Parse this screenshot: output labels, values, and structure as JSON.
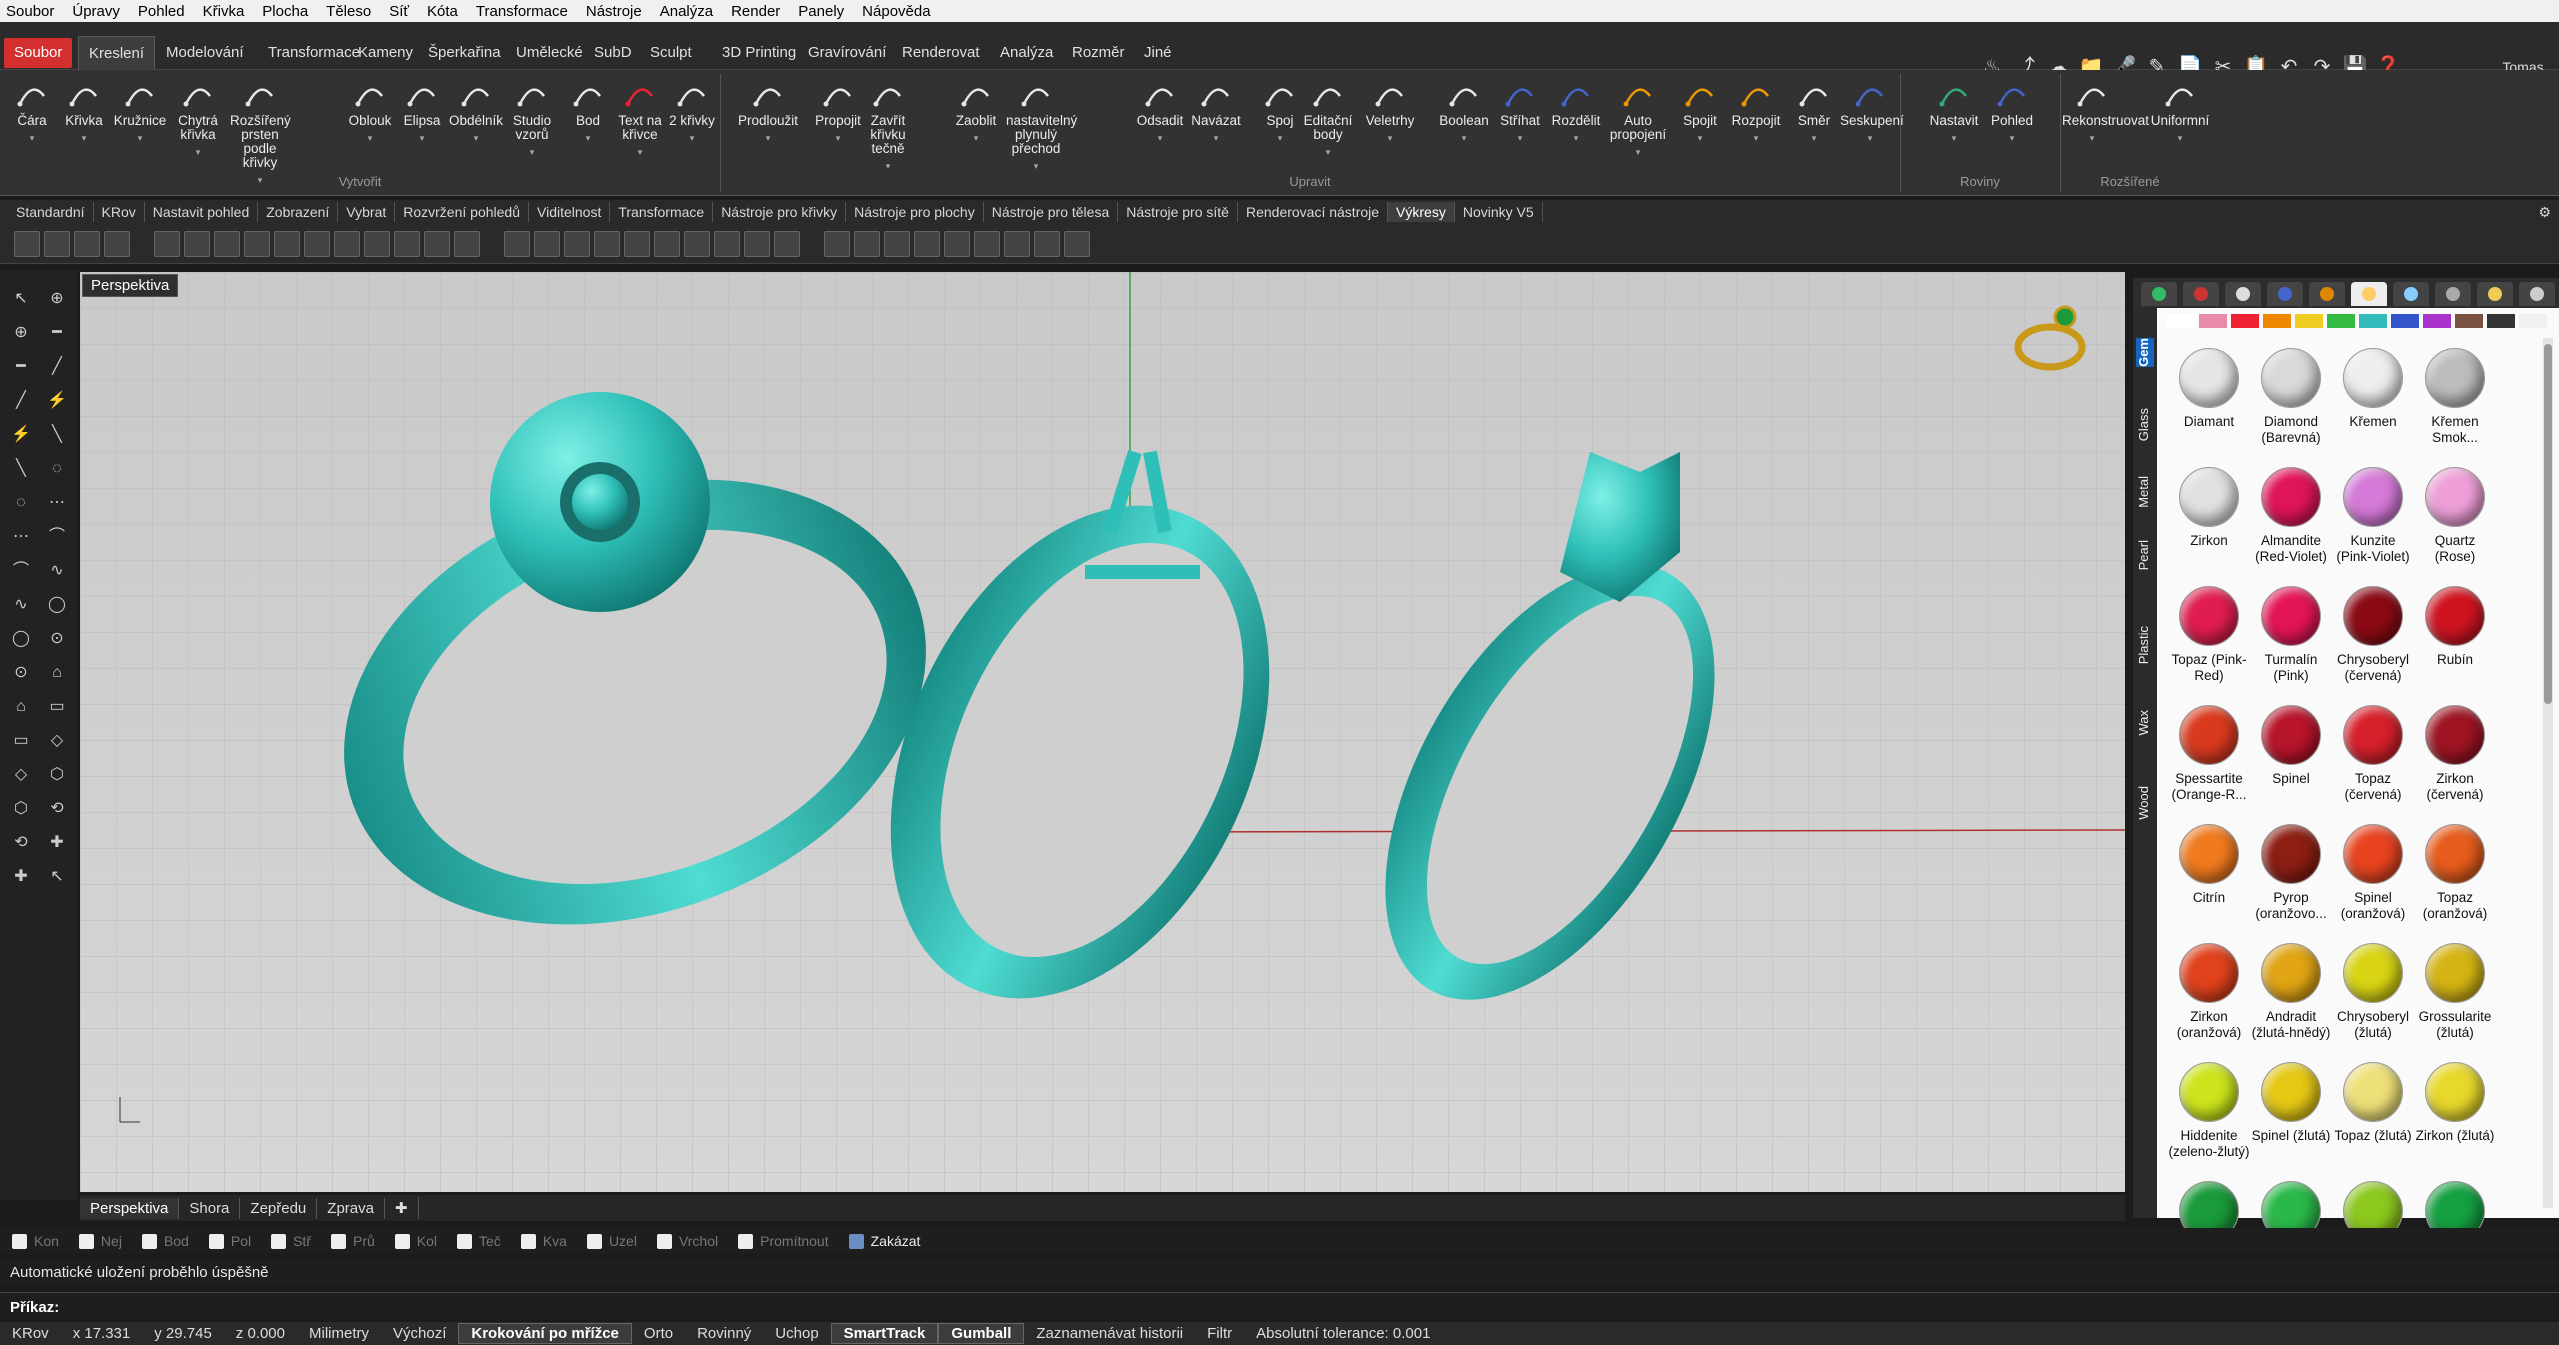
{
  "menu": [
    "Soubor",
    "Úpravy",
    "Pohled",
    "Křivka",
    "Plocha",
    "Těleso",
    "Síť",
    "Kóta",
    "Transformace",
    "Nástroje",
    "Analýza",
    "Render",
    "Panely",
    "Nápověda"
  ],
  "ribbon_tabs": [
    "Soubor",
    "Kreslení",
    "Modelování",
    "Transformace",
    "Kameny",
    "Šperkařina",
    "Umělecké",
    "SubD",
    "Sculpt",
    "3D Printing",
    "Gravírování",
    "Renderovat",
    "Analýza",
    "Rozměr",
    "Jiné"
  ],
  "active_ribbon_tab": "Kreslení",
  "user": "Tomas",
  "ribbon_buttons": [
    "Čára",
    "Křivka",
    "Kružnice",
    "Chytrá křivka",
    "Rozšířený prsten podle křivky",
    "Oblouk",
    "Elipsa",
    "Obdélník",
    "Studio vzorů",
    "Bod",
    "Text na křivce",
    "2 křivky",
    "Prodloužit",
    "Propojit",
    "Zavřít křivku tečně",
    "Zaoblit",
    "nastavitelný plynulý přechod",
    "Odsadit",
    "Navázat",
    "Spoj",
    "Editační body",
    "Veletrhy",
    "Boolean",
    "Stříhat",
    "Rozdělit",
    "Auto propojení",
    "Spojit",
    "Rozpojit",
    "Směr",
    "Seskupení",
    "Nastavit",
    "Pohled",
    "Rekonstruovat",
    "Uniformní"
  ],
  "ribbon_groups": [
    "Vytvořit",
    "Upravit",
    "Roviny",
    "Rozšířené"
  ],
  "toolbar_tabs": [
    "Standardní",
    "KRov",
    "Nastavit pohled",
    "Zobrazení",
    "Vybrat",
    "Rozvržení pohledů",
    "Viditelnost",
    "Transformace",
    "Nástroje pro křivky",
    "Nástroje pro plochy",
    "Nástroje pro tělesa",
    "Nástroje pro sítě",
    "Renderovací nástroje",
    "Výkresy",
    "Novinky V5"
  ],
  "active_toolbar_tab": "Výkresy",
  "viewport": {
    "title": "Perspektiva"
  },
  "viewport_tabs": [
    "Perspektiva",
    "Shora",
    "Zepředu",
    "Zprava"
  ],
  "active_viewport_tab": "Perspektiva",
  "osnaps": [
    {
      "label": "Kon",
      "on": false
    },
    {
      "label": "Nej",
      "on": false
    },
    {
      "label": "Bod",
      "on": false
    },
    {
      "label": "Pol",
      "on": false
    },
    {
      "label": "Stř",
      "on": false
    },
    {
      "label": "Prů",
      "on": false
    },
    {
      "label": "Kol",
      "on": false
    },
    {
      "label": "Teč",
      "on": false
    },
    {
      "label": "Kva",
      "on": false
    },
    {
      "label": "Uzel",
      "on": false
    },
    {
      "label": "Vrchol",
      "on": false
    },
    {
      "label": "Promítnout",
      "on": false
    },
    {
      "label": "Zakázat",
      "on": true
    }
  ],
  "command_history": "Automatické uložení proběhlo úspěšně",
  "command_prompt": "Příkaz:",
  "status": {
    "layer": "KRov",
    "x": "x 17.331",
    "y": "y 29.745",
    "z": "z 0.000",
    "units": "Milimetry",
    "default": "Výchozí",
    "items": [
      "Krokování po mřížce",
      "Orto",
      "Rovinný",
      "Uchop",
      "SmartTrack",
      "Gumball",
      "Zaznamenávat historii",
      "Filtr",
      "Absolutní tolerance: 0.001"
    ]
  },
  "panel": {
    "vertical_tabs": [
      "Gem",
      "Glass",
      "Metal",
      "Pearl",
      "Plastic",
      "Wax",
      "Wood"
    ],
    "active_vertical_tab": "Gem",
    "gems": [
      {
        "name": "Diamant",
        "color": "#e6e6e6"
      },
      {
        "name": "Diamond (Barevná)",
        "color": "#d9d9d9"
      },
      {
        "name": "Křemen",
        "color": "#eeeeee"
      },
      {
        "name": "Křemen Smok...",
        "color": "#bdbdbd"
      },
      {
        "name": "Zirkon",
        "color": "#e0e0e0"
      },
      {
        "name": "Almandite (Red-Violet)",
        "color": "#e0145a"
      },
      {
        "name": "Kunzite (Pink-Violet)",
        "color": "#d57ad8"
      },
      {
        "name": "Quartz (Rose)",
        "color": "#ef9fd8"
      },
      {
        "name": "Topaz (Pink-Red)",
        "color": "#e01d4e"
      },
      {
        "name": "Turmalín (Pink)",
        "color": "#e41554"
      },
      {
        "name": "Chrysoberyl (červená)",
        "color": "#8b0a14"
      },
      {
        "name": "Rubín",
        "color": "#cf1420"
      },
      {
        "name": "Spessartite (Orange-R...",
        "color": "#d93a1e"
      },
      {
        "name": "Spinel",
        "color": "#b8142a"
      },
      {
        "name": "Topaz (červená)",
        "color": "#d6202c"
      },
      {
        "name": "Zirkon (červená)",
        "color": "#9e1422"
      },
      {
        "name": "Citrín",
        "color": "#f07a1e"
      },
      {
        "name": "Pyrop (oranžovo...",
        "color": "#8c1e12"
      },
      {
        "name": "Spinel (oranžová)",
        "color": "#e84420"
      },
      {
        "name": "Topaz (oranžová)",
        "color": "#e65c1c"
      },
      {
        "name": "Zirkon (oranžová)",
        "color": "#e0421c"
      },
      {
        "name": "Andradit (žlutá-hnědý)",
        "color": "#e0a414"
      },
      {
        "name": "Chrysoberyl (žlutá)",
        "color": "#d8d414"
      },
      {
        "name": "Grossularite (žlutá)",
        "color": "#d4b414"
      },
      {
        "name": "Hiddenite (zeleno-žlutý)",
        "color": "#cce41c"
      },
      {
        "name": "Spinel (žlutá)",
        "color": "#e4c814"
      },
      {
        "name": "Topaz (žlutá)",
        "color": "#eee078"
      },
      {
        "name": "Zirkon (žlutá)",
        "color": "#e8d82c"
      },
      {
        "name": "",
        "color": "#1a9a3a"
      },
      {
        "name": "",
        "color": "#2ab84a"
      },
      {
        "name": "",
        "color": "#8cc81e"
      },
      {
        "name": "",
        "color": "#14a040"
      }
    ]
  },
  "colors": {
    "accent": "#d32f2f",
    "model": "#2ec0b8",
    "panel_tab": "#1565c0"
  }
}
